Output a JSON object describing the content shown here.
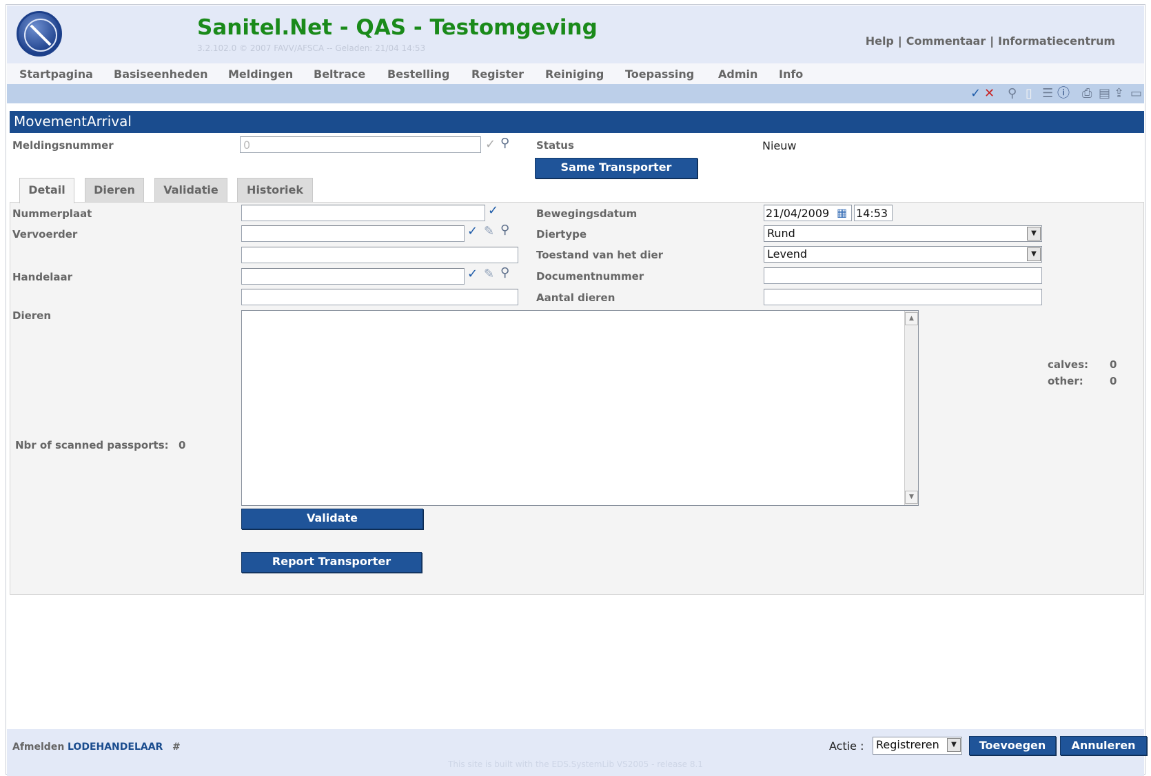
{
  "header": {
    "title": "Sanitel.Net - QAS - Testomgeving",
    "version": "3.2.102.0 © 2007 FAVV/AFSCA -- Geladen: 21/04 14:53",
    "links": [
      "Help",
      "Commentaar",
      "Informatiecentrum"
    ]
  },
  "menu": [
    "Startpagina",
    "Basiseenheden",
    "Meldingen",
    "Beltrace",
    "Bestelling",
    "Register",
    "Reiniging",
    "Toepassing",
    "Admin",
    "Info"
  ],
  "toolbar_icons": [
    "check-icon",
    "delete-icon",
    "search-icon",
    "new-document-icon",
    "list-icon",
    "info-icon",
    "print-icon",
    "save-icon",
    "export-icon",
    "card-icon"
  ],
  "panel": {
    "title": "MovementArrival",
    "meldingsnummer_label": "Meldingsnummer",
    "meldingsnummer_value": "0",
    "status_label": "Status",
    "status_value": "Nieuw",
    "same_transporter": "Same Transporter"
  },
  "tabs": [
    "Detail",
    "Dieren",
    "Validatie",
    "Historiek"
  ],
  "detail": {
    "nummerplaat": "Nummerplaat",
    "vervoerder": "Vervoerder",
    "handelaar": "Handelaar",
    "dieren": "Dieren",
    "scanned_label": "Nbr of scanned passports:",
    "scanned_value": "0",
    "bewegingsdatum": "Bewegingsdatum",
    "date_value": "21/04/2009",
    "time_value": "14:53",
    "diertype": "Diertype",
    "diertype_value": "Rund",
    "toestand": "Toestand van het dier",
    "toestand_value": "Levend",
    "documentnummer": "Documentnummer",
    "aantal": "Aantal dieren",
    "calves_label": "calves:",
    "calves_value": "0",
    "other_label": "other:",
    "other_value": "0",
    "validate": "Validate",
    "report_transporter": "Report Transporter"
  },
  "footer": {
    "logout": "Afmelden",
    "user": "LODEHANDELAAR",
    "hash": "#",
    "actie_label": "Actie :",
    "actie_value": "Registreren",
    "add": "Toevoegen",
    "cancel": "Annuleren",
    "built": "This site is built with the EDS.SystemLib VS2005 - release 8.1"
  }
}
